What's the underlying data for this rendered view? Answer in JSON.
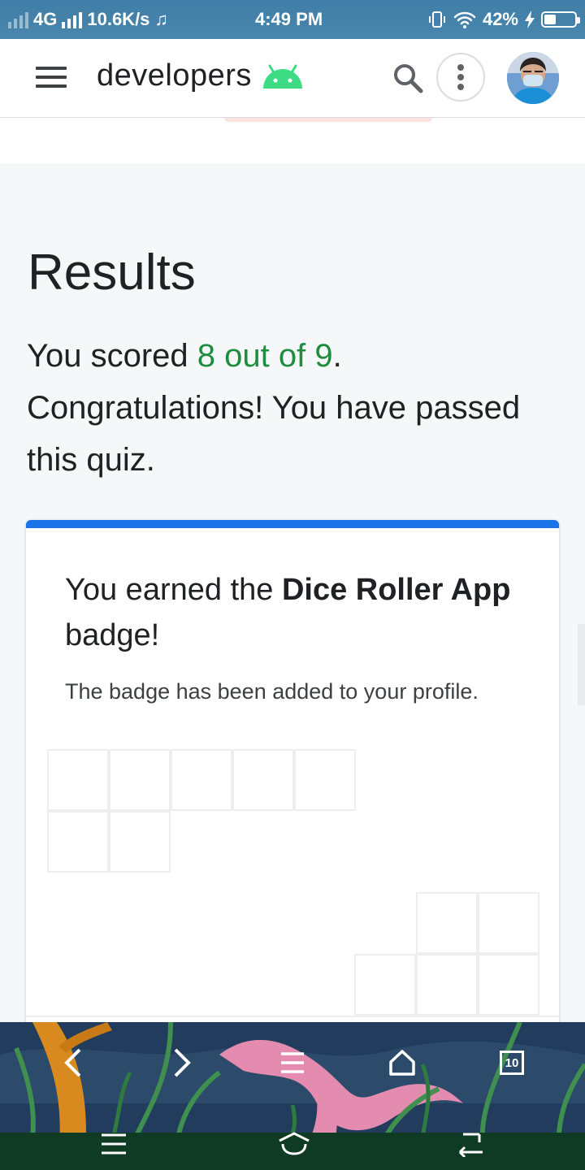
{
  "status_bar": {
    "network": "4G",
    "speed": "10.6K/s",
    "time": "4:49 PM",
    "battery": "42%",
    "icons": [
      "signal-icon",
      "music-note-icon",
      "vibrate-icon",
      "wifi-icon",
      "charging-icon",
      "battery-icon"
    ]
  },
  "header": {
    "brand": "developers",
    "icons": [
      "menu-icon",
      "android-logo-icon",
      "search-icon",
      "more-vert-icon",
      "avatar"
    ]
  },
  "results": {
    "title": "Results",
    "score_prefix": "You scored ",
    "score_value": "8 out of 9",
    "score_suffix": ". Congratulations! You have passed this quiz."
  },
  "badge": {
    "prefix": "You earned the ",
    "name": "Dice Roller App",
    "suffix": " badge!",
    "subtitle": "The badge has been added to your profile."
  },
  "browser_bar": {
    "tab_count": "10",
    "icons": [
      "back-icon",
      "forward-icon",
      "menu-lines-icon",
      "home-icon",
      "tabs-icon"
    ]
  },
  "system_nav": {
    "icons": [
      "recent-apps-icon",
      "home-nav-icon",
      "back-nav-icon"
    ]
  },
  "colors": {
    "accent_blue": "#1a73e8",
    "score_green": "#1e8e3e",
    "android_green": "#3ddc84",
    "status_bar": "#4a86ad"
  }
}
